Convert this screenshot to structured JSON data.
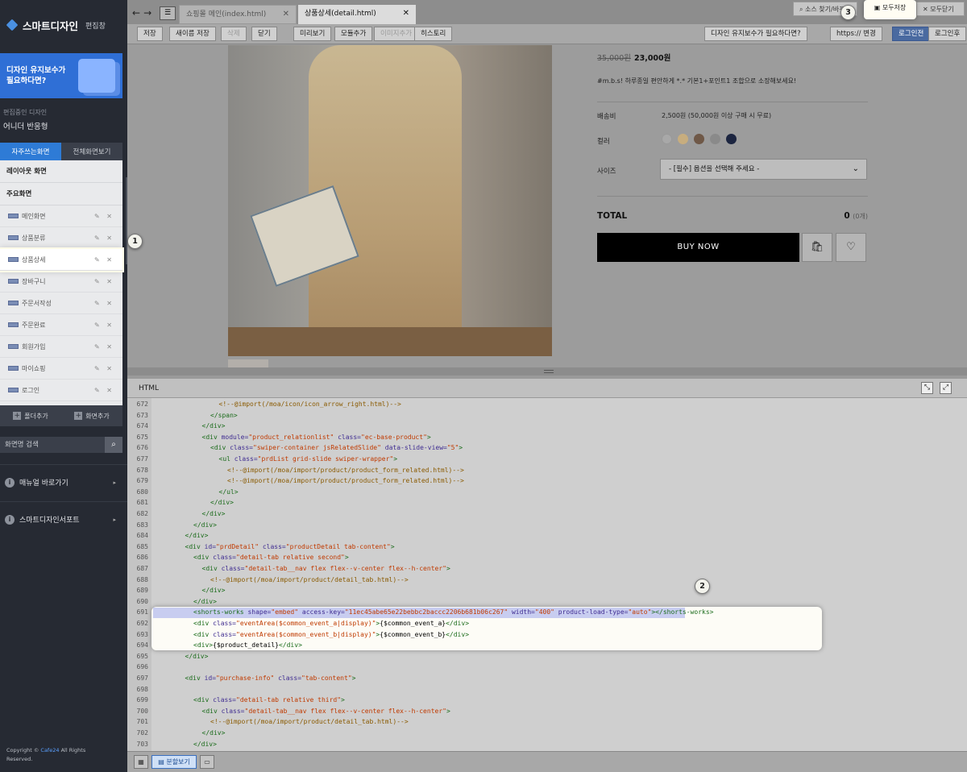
{
  "sidebar": {
    "app_name": "스마트디자인",
    "edit_label": "편집창",
    "banner_text": [
      "디자인 유지보수가",
      "필요하다면?"
    ],
    "current_design_label": "편집중인 디자인",
    "current_design_value": "어니더 반응형",
    "tabs": [
      "자주쓰는화면",
      "전체화면보기"
    ],
    "sections": [
      "레이아웃 화면",
      "주요화면"
    ],
    "screens": [
      "메인화면",
      "상품분류",
      "상품상세",
      "장바구니",
      "주문서작성",
      "주문완료",
      "회원가입",
      "마이쇼핑",
      "로그인"
    ],
    "screen_actions": "✎ ✕",
    "footer_buttons": [
      "폴더추가",
      "화면추가"
    ],
    "search_placeholder": "화면명 검색",
    "search_icon": "magnifier-icon",
    "menus": [
      "매뉴얼 바로가기",
      "스마트디자인서포트"
    ],
    "copyright_prefix": "Copyright ©",
    "copyright_brand": "Cafe24",
    "copyright_suffix": "All Rights Reserved."
  },
  "topbar": {
    "file_tabs": [
      {
        "label": "쇼핑몰 메인(index.html)"
      },
      {
        "label": "상품상세(detail.html)"
      }
    ],
    "right_buttons": [
      "소스 찾기/바꾸기",
      "모두저장",
      "모두닫기"
    ]
  },
  "toolbar": {
    "left": [
      "저장",
      "새이름 저장",
      "삭제",
      "닫기"
    ],
    "mid": [
      "미리보기",
      "모듈추가",
      "이미지추가",
      "히스토리"
    ],
    "right": [
      "디자인 유지보수가 필요하다면?",
      "https:// 변경",
      "로그인전",
      "로그인후"
    ]
  },
  "product": {
    "old_price": "35,000원",
    "price": "23,000원",
    "description": "#m.b.s! 하루종일 편안하게 *.* 기본1+포인트1 조합으로 소장해보세요!",
    "shipping_label": "배송비",
    "shipping_value": "2,500원 (50,000원 이상 구매 시 무료)",
    "color_label": "컬러",
    "colors": [
      "#c8c8c8",
      "#c7ad7e",
      "#6f5847",
      "#8a8a8a",
      "#1c2540"
    ],
    "size_label": "사이즈",
    "size_placeholder": "- [필수] 옵션을 선택해 주세요 -",
    "total_label": "TOTAL",
    "total_value": "0",
    "total_count": "(0개)",
    "buy_label": "BUY NOW",
    "cart_icon": "shopping-bag-icon",
    "wish_icon": "heart-icon"
  },
  "editor": {
    "panel_title": "HTML",
    "lines": [
      {
        "n": "672",
        "i": 7,
        "p": [
          [
            "cm",
            "<!--@import(/moa/icon/icon_arrow_right.html)-->"
          ]
        ]
      },
      {
        "n": "673",
        "i": 6,
        "p": [
          [
            "tg",
            "</span>"
          ]
        ]
      },
      {
        "n": "674",
        "i": 5,
        "p": [
          [
            "tg",
            "</div>"
          ]
        ]
      },
      {
        "n": "675",
        "i": 5,
        "p": [
          [
            "tg",
            "<div "
          ],
          [
            "at",
            "module="
          ],
          [
            "av",
            "\"product_relationlist\" "
          ],
          [
            "at",
            "class="
          ],
          [
            "av",
            "\"ec-base-product\""
          ],
          [
            "tg",
            ">"
          ]
        ]
      },
      {
        "n": "676",
        "i": 6,
        "p": [
          [
            "tg",
            "<div "
          ],
          [
            "at",
            "class="
          ],
          [
            "av",
            "\"swiper-container jsRelatedSlide\" "
          ],
          [
            "at",
            "data-slide-view="
          ],
          [
            "av",
            "\"5\""
          ],
          [
            "tg",
            ">"
          ]
        ]
      },
      {
        "n": "677",
        "i": 7,
        "p": [
          [
            "tg",
            "<ul "
          ],
          [
            "at",
            "class="
          ],
          [
            "av",
            "\"prdList grid-slide swiper-wrapper\""
          ],
          [
            "tg",
            ">"
          ]
        ]
      },
      {
        "n": "678",
        "i": 8,
        "p": [
          [
            "cm",
            "<!--@import(/moa/import/product/product_form_related.html)-->"
          ]
        ]
      },
      {
        "n": "679",
        "i": 8,
        "p": [
          [
            "cm",
            "<!--@import(/moa/import/product/product_form_related.html)-->"
          ]
        ]
      },
      {
        "n": "680",
        "i": 7,
        "p": [
          [
            "tg",
            "</ul>"
          ]
        ]
      },
      {
        "n": "681",
        "i": 6,
        "p": [
          [
            "tg",
            "</div>"
          ]
        ]
      },
      {
        "n": "682",
        "i": 5,
        "p": [
          [
            "tg",
            "</div>"
          ]
        ]
      },
      {
        "n": "683",
        "i": 4,
        "p": [
          [
            "tg",
            "</div>"
          ]
        ]
      },
      {
        "n": "684",
        "i": 3,
        "p": [
          [
            "tg",
            "</div>"
          ]
        ]
      },
      {
        "n": "685",
        "i": 3,
        "p": [
          [
            "tg",
            "<div "
          ],
          [
            "at",
            "id="
          ],
          [
            "av",
            "\"prdDetail\" "
          ],
          [
            "at",
            "class="
          ],
          [
            "av",
            "\"productDetail tab-content\""
          ],
          [
            "tg",
            ">"
          ]
        ]
      },
      {
        "n": "686",
        "i": 4,
        "p": [
          [
            "tg",
            "<div "
          ],
          [
            "at",
            "class="
          ],
          [
            "av",
            "\"detail-tab relative second\""
          ],
          [
            "tg",
            ">"
          ]
        ]
      },
      {
        "n": "687",
        "i": 5,
        "p": [
          [
            "tg",
            "<div "
          ],
          [
            "at",
            "class="
          ],
          [
            "av",
            "\"detail-tab__nav flex flex--v-center flex--h-center\""
          ],
          [
            "tg",
            ">"
          ]
        ]
      },
      {
        "n": "688",
        "i": 6,
        "p": [
          [
            "cm",
            "<!--@import(/moa/import/product/detail_tab.html)-->"
          ]
        ]
      },
      {
        "n": "689",
        "i": 5,
        "p": [
          [
            "tg",
            "</div>"
          ]
        ]
      },
      {
        "n": "690",
        "i": 4,
        "p": [
          [
            "tg",
            "</div>"
          ]
        ]
      },
      {
        "n": "691",
        "i": 4,
        "p": [
          [
            "tg",
            "<shorts-works "
          ],
          [
            "at",
            "shape="
          ],
          [
            "av",
            "\"embed\" "
          ],
          [
            "at",
            "access-key="
          ],
          [
            "av",
            "\"11ec45abe65e22bebbc2baccc2206b681b06c267\" "
          ],
          [
            "at",
            "width="
          ],
          [
            "av",
            "\"400\" "
          ],
          [
            "at",
            "product-load-type="
          ],
          [
            "av",
            "\"auto\""
          ],
          [
            "tg",
            "></shorts-works>"
          ]
        ]
      },
      {
        "n": "692",
        "i": 4,
        "p": [
          [
            "tg",
            "<div "
          ],
          [
            "at",
            "class="
          ],
          [
            "av",
            "\"eventArea($common_event_a|display)\""
          ],
          [
            "tg",
            ">"
          ],
          [
            "tx",
            "{$common_event_a}"
          ],
          [
            "tg",
            "</div>"
          ]
        ]
      },
      {
        "n": "693",
        "i": 4,
        "p": [
          [
            "tg",
            "<div "
          ],
          [
            "at",
            "class="
          ],
          [
            "av",
            "\"eventArea($common_event_b|display)\""
          ],
          [
            "tg",
            ">"
          ],
          [
            "tx",
            "{$common_event_b}"
          ],
          [
            "tg",
            "</div>"
          ]
        ]
      },
      {
        "n": "694",
        "i": 4,
        "p": [
          [
            "tg",
            "<div>"
          ],
          [
            "tx",
            "{$product_detail}"
          ],
          [
            "tg",
            "</div>"
          ]
        ]
      },
      {
        "n": "695",
        "i": 3,
        "p": [
          [
            "tg",
            "</div>"
          ]
        ]
      },
      {
        "n": "696",
        "i": 0,
        "p": []
      },
      {
        "n": "697",
        "i": 3,
        "p": [
          [
            "tg",
            "<div "
          ],
          [
            "at",
            "id="
          ],
          [
            "av",
            "\"purchase-info\" "
          ],
          [
            "at",
            "class="
          ],
          [
            "av",
            "\"tab-content\""
          ],
          [
            "tg",
            ">"
          ]
        ]
      },
      {
        "n": "698",
        "i": 0,
        "p": []
      },
      {
        "n": "699",
        "i": 4,
        "p": [
          [
            "tg",
            "<div "
          ],
          [
            "at",
            "class="
          ],
          [
            "av",
            "\"detail-tab relative third\""
          ],
          [
            "tg",
            ">"
          ]
        ]
      },
      {
        "n": "700",
        "i": 5,
        "p": [
          [
            "tg",
            "<div "
          ],
          [
            "at",
            "class="
          ],
          [
            "av",
            "\"detail-tab__nav flex flex--v-center flex--h-center\""
          ],
          [
            "tg",
            ">"
          ]
        ]
      },
      {
        "n": "701",
        "i": 6,
        "p": [
          [
            "cm",
            "<!--@import(/moa/import/product/detail_tab.html)-->"
          ]
        ]
      },
      {
        "n": "702",
        "i": 5,
        "p": [
          [
            "tg",
            "</div>"
          ]
        ]
      },
      {
        "n": "703",
        "i": 4,
        "p": [
          [
            "tg",
            "</div>"
          ]
        ]
      }
    ],
    "status_buttons": [
      "분할보기"
    ]
  },
  "callouts": [
    "1",
    "2",
    "3"
  ]
}
